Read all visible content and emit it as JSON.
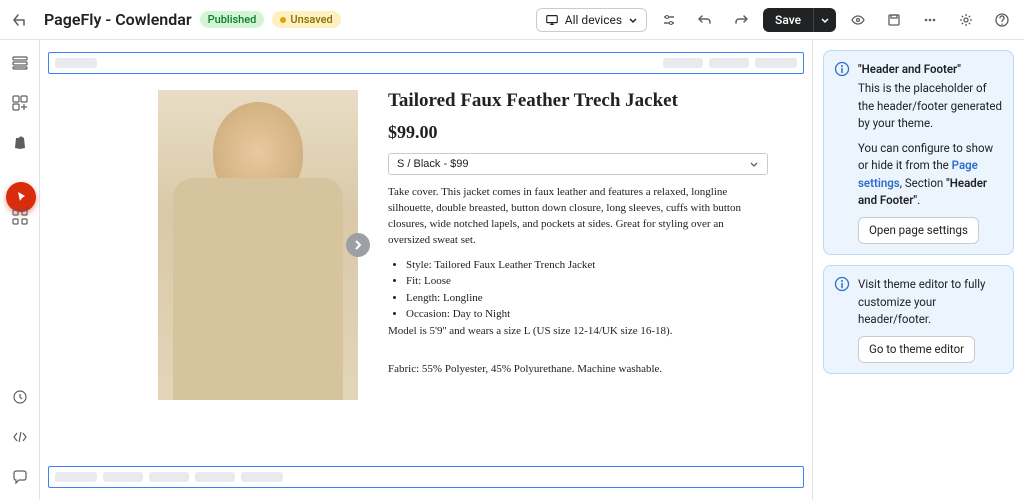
{
  "header": {
    "title": "PageFly - Cowlendar",
    "badge_published": "Published",
    "badge_unsaved": "Unsaved",
    "device_label": "All devices",
    "save_label": "Save"
  },
  "product": {
    "title": "Tailored Faux Feather Trech Jacket",
    "price": "$99.00",
    "variant": "S / Black - $99",
    "description": "Take cover. This jacket comes in faux leather and features a relaxed, longline silhouette, double breasted, button down closure, long sleeves, cuffs with button closures, wide notched lapels, and pockets at sides. Great for styling over an oversized sweat set.",
    "bullets": {
      "b1": "Style: Tailored Faux Leather Trench Jacket",
      "b2": "Fit: Loose",
      "b3": "Length: Longline",
      "b4": "Occasion: Day to Night"
    },
    "model_note": "Model is 5'9'' and wears a size L (US size 12-14/UK size 16-18).",
    "fabric": "Fabric: 55% Polyester, 45% Polyurethane. Machine washable."
  },
  "panel": {
    "card1_title": "\"Header and Footer\"",
    "card1_p1": "This is the placeholder of the header/footer generated by your theme.",
    "card1_p2a": "You can configure to show or hide it from the ",
    "card1_p2b": "Page settings",
    "card1_p2c": ", Section ",
    "card1_p2d": "\"Header and Footer\"",
    "card1_btn": "Open page settings",
    "card2_text": "Visit theme editor to fully customize your header/footer.",
    "card2_btn": "Go to theme editor"
  }
}
